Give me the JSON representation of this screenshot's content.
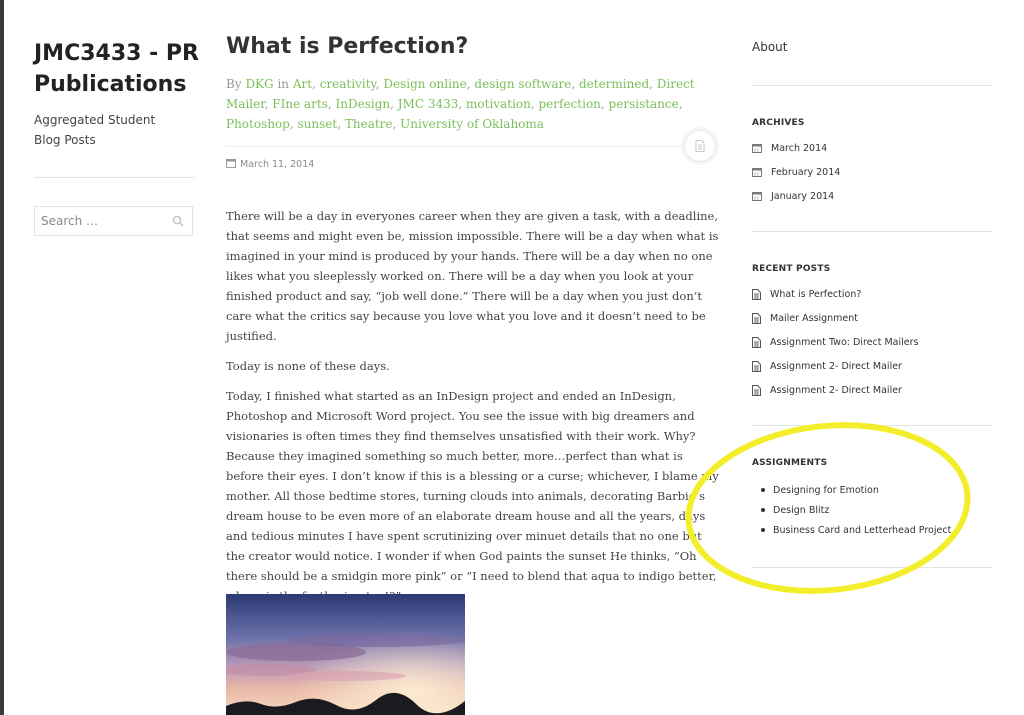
{
  "site": {
    "title": "JMC3433 - PR Publications",
    "description": "Aggregated Student Blog Posts"
  },
  "search": {
    "placeholder": "Search …"
  },
  "post": {
    "title": "What is Perfection?",
    "by": "By",
    "author": "DKG",
    "in": "in",
    "categories": [
      "Art",
      "creativity",
      "Design online",
      "design software",
      "determined",
      "Direct Mailer",
      "FIne arts",
      "InDesign",
      "JMC 3433",
      "motivation",
      "perfection",
      "persistance",
      "Photoshop",
      "sunset",
      "Theatre",
      "University of Oklahoma"
    ],
    "date": "March 11, 2014",
    "paragraphs": [
      "There will be a day in everyones career when they are given a task, with a deadline, that seems and might even be, mission impossible. There will be a day when what is imagined in your mind is produced by your hands. There will be a day when no one likes what you sleeplessly worked on. There will be a day when you look at your finished product and say, “job well done.” There will be a day when you just don’t care what the critics say because you love what you love and it doesn’t need to be justified.",
      "Today is none of these days.",
      "Today, I finished what started as an InDesign project and ended an InDesign, Photoshop and Microsoft Word project. You see the issue with big dreamers and visionaries is often times they find themselves unsatisfied with their work. Why? Because they imagined something so much better, more…perfect than what is before their eyes. I don’t know if this is a blessing or a curse; whichever, I blame my mother. All those bedtime stores, turning clouds into animals, decorating Barbie’s dream house to be even more of an elaborate dream house and all the years, days and tedious minutes I have spent scrutinizing over minuet details that no one but the creator would notice. I wonder if when God paints the sunset He thinks, “Oh there should be a smidgin more pink” or “I need to blend that aqua to indigo better, where is the feathering too!?”"
    ]
  },
  "sidebar": {
    "about": "About",
    "archives": {
      "title": "ARCHIVES",
      "items": [
        "March 2014",
        "February 2014",
        "January 2014"
      ]
    },
    "recent_posts": {
      "title": "RECENT POSTS",
      "items": [
        "What is Perfection?",
        "Mailer Assignment",
        "Assignment Two: Direct Mailers",
        "Assignment 2- Direct Mailer",
        "Assignment 2- Direct Mailer"
      ]
    },
    "assignments": {
      "title": "ASSIGNMENTS",
      "items": [
        "Designing for Emotion",
        "Design Blitz",
        "Business Card and Letterhead Project"
      ]
    }
  },
  "colors": {
    "link_green": "#7bbf5a",
    "highlight_yellow": "#f3ee2b",
    "text": "#333333"
  },
  "icons": {
    "search": "search-icon",
    "calendar": "calendar-icon",
    "document": "document-icon"
  }
}
